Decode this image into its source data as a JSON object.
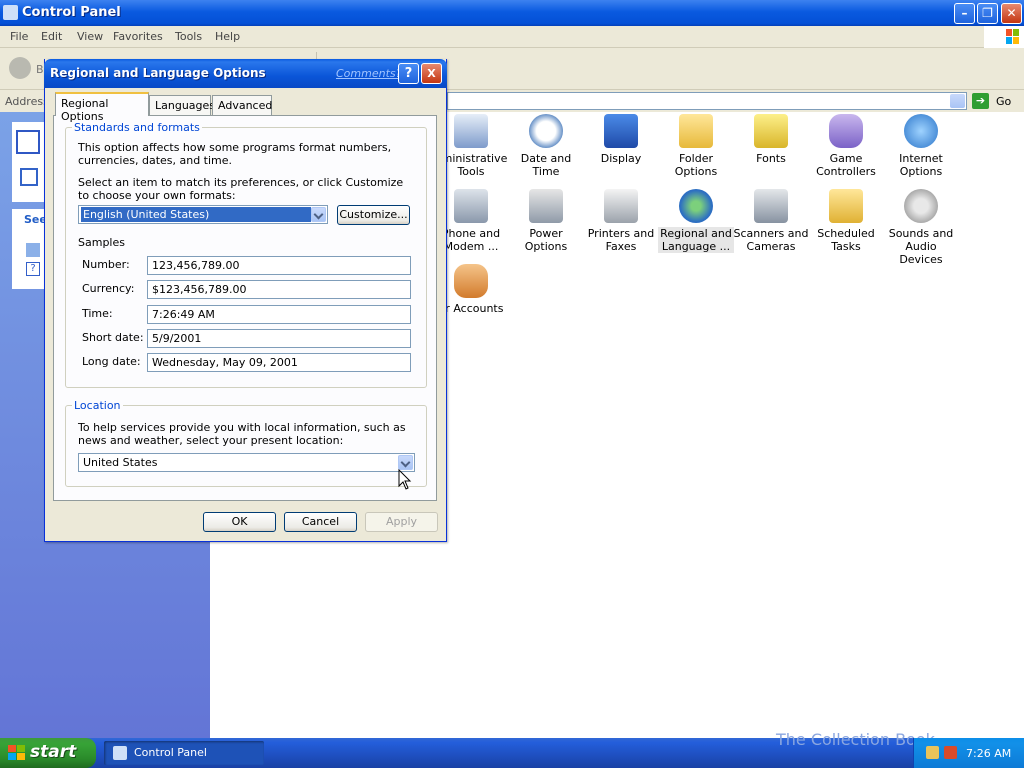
{
  "window": {
    "title": "Control Panel",
    "menu": [
      "File",
      "Edit",
      "View",
      "Favorites",
      "Tools",
      "Help"
    ],
    "back_label": "B",
    "address_label": "Address",
    "go_label": "Go",
    "sidebar_see_label": "See"
  },
  "icons": [
    {
      "label": "dministrative Tools"
    },
    {
      "label": "Date and Time"
    },
    {
      "label": "Display"
    },
    {
      "label": "Folder Options"
    },
    {
      "label": "Fonts"
    },
    {
      "label": "Game Controllers"
    },
    {
      "label": "Internet Options"
    },
    {
      "label": "Phone and Modem ..."
    },
    {
      "label": "Power Options"
    },
    {
      "label": "Printers and Faxes"
    },
    {
      "label": "Regional and Language ..."
    },
    {
      "label": "Scanners and Cameras"
    },
    {
      "label": "Scheduled Tasks"
    },
    {
      "label": "Sounds and Audio Devices"
    },
    {
      "label": "er Accounts"
    }
  ],
  "dialog": {
    "title": "Regional and Language Options",
    "comments_link": "Comments?",
    "help_btn": "?",
    "close_btn": "X",
    "tabs": [
      "Regional Options",
      "Languages",
      "Advanced"
    ],
    "standards": {
      "legend": "Standards and formats",
      "description": "This option affects how some programs format numbers, currencies, dates, and time.",
      "select_prompt": "Select an item to match its preferences, or click Customize to choose your own formats:",
      "selected_format": "English (United States)",
      "customize_btn": "Customize..."
    },
    "samples": {
      "heading": "Samples",
      "rows": [
        {
          "label": "Number:",
          "value": "123,456,789.00"
        },
        {
          "label": "Currency:",
          "value": "$123,456,789.00"
        },
        {
          "label": "Time:",
          "value": "7:26:49 AM"
        },
        {
          "label": "Short date:",
          "value": "5/9/2001"
        },
        {
          "label": "Long date:",
          "value": "Wednesday, May 09, 2001"
        }
      ]
    },
    "location": {
      "legend": "Location",
      "description": "To help services provide you with local information, such as news and weather, select your present location:",
      "selected": "United States"
    },
    "buttons": {
      "ok": "OK",
      "cancel": "Cancel",
      "apply": "Apply"
    }
  },
  "taskbar": {
    "start_label": "start",
    "task_item": "Control Panel",
    "clock": "7:26 AM",
    "watermark": "The Collection Book"
  }
}
